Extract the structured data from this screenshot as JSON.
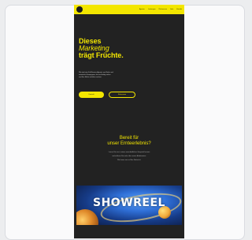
{
  "site": {
    "nav": [
      "Agentur",
      "Leistungen",
      "Referenzen",
      "Jobs",
      "Kontakt"
    ],
    "hero": {
      "title_line1": "Dieses",
      "title_line2": "Marketing",
      "title_line3": "trägt Früchte.",
      "copy_line1": "Wir sind eine Full-Service-Agentur aus Berlin und",
      "copy_line2": "entwickeln Kampagnen, die nachhaltig wirken",
      "copy_line3": "und Ihre Marke sichtbar machen.",
      "primary_cta": "Kontakt",
      "secondary_cta": "Referenzen"
    },
    "section": {
      "title_line1": "Bereit für",
      "title_line2": "unser Ernteerlebnis?",
      "copy_line1": "Lernen Sie uns in einem unverbindlichen Gespräch kennen",
      "copy_line2": "und erfahren Sie mehr über unsere Arbeitsweise.",
      "copy_line3": "Wir freuen uns auf Ihre Nachricht."
    },
    "showreel": {
      "label": "SHOWREEL"
    }
  },
  "colors": {
    "accent": "#f3e600",
    "background": "#222222",
    "card": "#fafafb"
  }
}
